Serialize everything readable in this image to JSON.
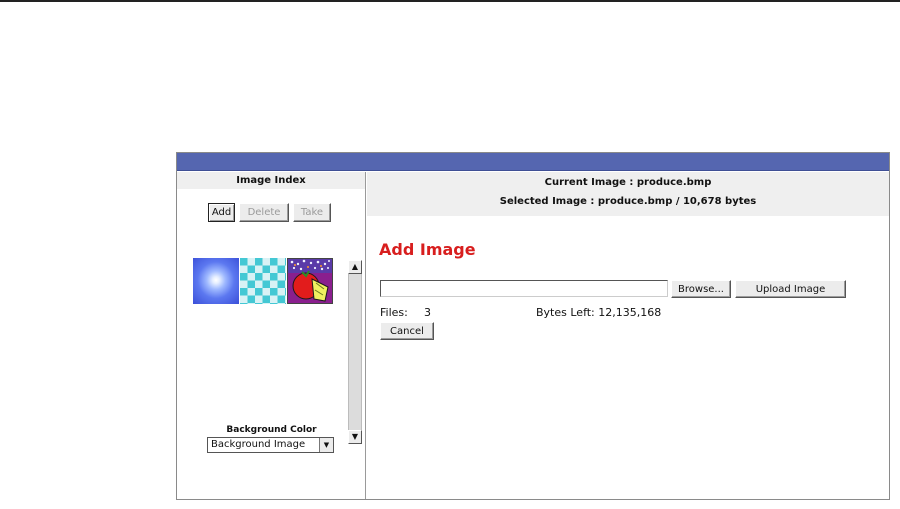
{
  "left_panel": {
    "header": "Image Index",
    "buttons": {
      "add": "Add",
      "delete": "Delete",
      "take": "Take"
    },
    "thumbnails": [
      {
        "name": "blue-sphere-thumbnail",
        "selected": false
      },
      {
        "name": "checkerboard-thumbnail",
        "selected": false
      },
      {
        "name": "produce-thumbnail",
        "selected": true
      }
    ],
    "scroll_up_icon": "scroll-up-arrow",
    "scroll_down_icon": "scroll-down-arrow",
    "background_color_label": "Background Color",
    "background_select_value": "Background Image"
  },
  "right_panel": {
    "current_image": "Current Image : produce.bmp",
    "selected_image": "Selected Image : produce.bmp / 10,678 bytes",
    "section_title": "Add Image",
    "file_input_value": "",
    "browse_label": "Browse...",
    "upload_label": "Upload Image",
    "files_label": "Files:",
    "files_count": "3",
    "bytes_left": "Bytes Left: 12,135,168",
    "cancel_label": "Cancel"
  },
  "colors": {
    "title_bar": "#5566b0",
    "section_title": "#d81e1e",
    "header_bg": "#efefef"
  }
}
